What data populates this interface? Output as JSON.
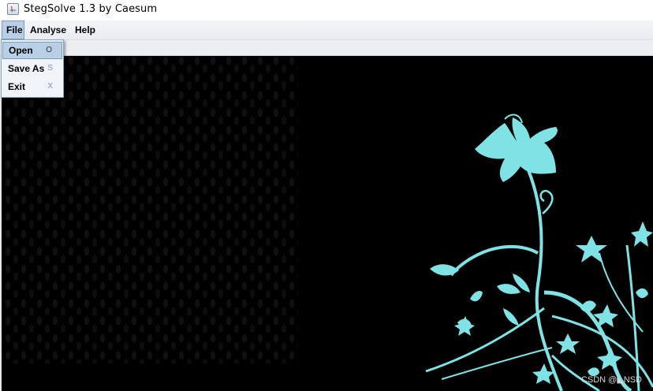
{
  "window": {
    "title": "StegSolve 1.3 by Caesum"
  },
  "menubar": {
    "items": [
      {
        "label": "File",
        "active": true
      },
      {
        "label": "Analyse",
        "active": false
      },
      {
        "label": "Help",
        "active": false
      }
    ]
  },
  "file_menu": {
    "items": [
      {
        "label": "Open",
        "accelerator": "O",
        "highlighted": true
      },
      {
        "label": "Save As",
        "accelerator": "S",
        "highlighted": false
      },
      {
        "label": "Exit",
        "accelerator": "X",
        "highlighted": false
      }
    ]
  },
  "image": {
    "flower_color": "#7fe3e6",
    "background_color": "#000000"
  },
  "watermark": {
    "text": "CSDN @◣NSD"
  }
}
